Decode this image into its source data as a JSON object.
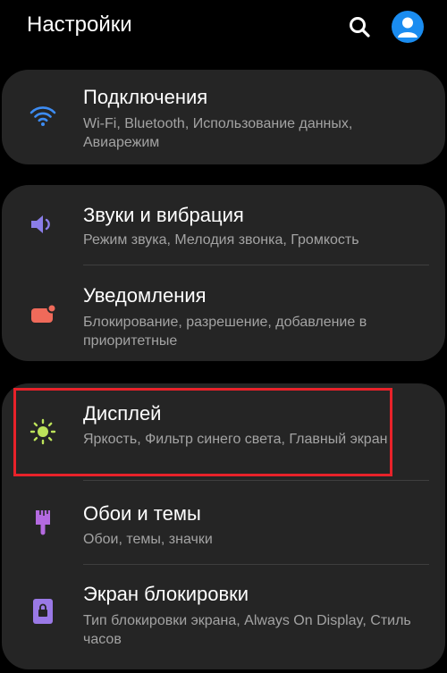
{
  "header": {
    "title": "Настройки",
    "search_icon": "search-icon",
    "account_icon": "account-icon"
  },
  "groups": [
    {
      "items": [
        {
          "title": "Подключения",
          "subtitle": "Wi-Fi, Bluetooth, Использование данных, Авиарежим",
          "icon": "wifi-icon",
          "icon_color": "#3d8cf3"
        }
      ]
    },
    {
      "items": [
        {
          "title": "Звуки и вибрация",
          "subtitle": "Режим звука, Мелодия звонка, Громкость",
          "icon": "speaker-icon",
          "icon_color": "#8a7de8"
        },
        {
          "title": "Уведомления",
          "subtitle": "Блокирование, разрешение, добавление в приоритетные",
          "icon": "notification-icon",
          "icon_color": "#ef6a5a"
        }
      ]
    },
    {
      "items": [
        {
          "title": "Дисплей",
          "subtitle": "Яркость, Фильтр синего света, Главный экран",
          "icon": "brightness-icon",
          "icon_color": "#bde35a",
          "highlighted": true
        },
        {
          "title": "Обои и темы",
          "subtitle": "Обои, темы, значки",
          "icon": "paintbrush-icon",
          "icon_color": "#b46ae0"
        },
        {
          "title": "Экран блокировки",
          "subtitle": "Тип блокировки экрана, Always On Display, Стиль часов",
          "icon": "lock-screen-icon",
          "icon_color": "#9a79e6"
        }
      ]
    }
  ],
  "colors": {
    "background": "#000000",
    "card": "#252525",
    "highlight_border": "#e8222a",
    "account_blue": "#1a8cf0",
    "subtitle_text": "#a3a3a3"
  }
}
